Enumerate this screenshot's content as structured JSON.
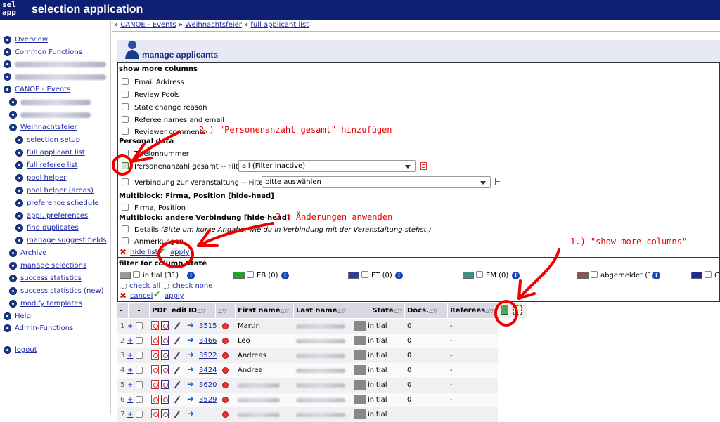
{
  "header": {
    "logo_line1": "sel",
    "logo_line2": "app",
    "title": "selection application"
  },
  "sidebar": {
    "overview": "Overview",
    "common_functions": "Common Functions",
    "canoe_events": "CANOE - Events",
    "weihnachtsfeier": "Weihnachtsfeier",
    "selection_setup": "selection setup",
    "full_applicant_list": "full applicant list",
    "full_referee_list": "full referee list",
    "pool_helper": "pool helper",
    "pool_helper_areas": "pool helper (areas)",
    "preference_schedule": "preference schedule",
    "appl_preferences": "appl. preferences",
    "find_duplicates": "find duplicates",
    "manage_suggest_fields": "manage suggest fields",
    "archive": "Archive",
    "manage_selections": "manage selections",
    "success_statistics": "success statistics",
    "success_statistics_new": "success statistics (new)",
    "modify_templates": "modify templates",
    "help": "Help",
    "admin_functions": "Admin-Functions",
    "logout": "logout"
  },
  "breadcrumb": {
    "prefix": "»",
    "c1": "CANOE - Events",
    "sep": "»",
    "c2": "Weihnachtsfeier",
    "c3": "full applicant list"
  },
  "page_title": "manage applicants",
  "columns_panel": {
    "heading": "show more columns",
    "email": "Email Address",
    "review_pools": "Review Pools",
    "state_change_reason": "State change reason",
    "referee_names": "Referee names and email",
    "reviewer_comments": "Reviewer comments",
    "personal_data_heading": "Personal data",
    "telefonnummer": "Telefonnummer",
    "personenanzahl": "Personenanzahl gesamt -- Filter:",
    "personenanzahl_select": "all (Filter inactive)",
    "verbindung": "Verbindung zur Veranstaltung -- Filter:",
    "verbindung_select": "bitte auswählen",
    "mb_firma_heading": "Multiblock: Firma, Position [hide-head]",
    "firma_position": "Firma, Position",
    "mb_verbindung_heading": "Multiblock: andere Verbindung [hide-head]",
    "details": "Details",
    "details_hint": "(Bitte um kurze Angabe, wie du in Verbindung mit der Veranstaltung stehst.)",
    "anmerkungen": "Anmerkungen",
    "hide_list": "hide list",
    "apply": "apply"
  },
  "state_filter": {
    "heading": "filter for column State",
    "states": [
      {
        "label": "initial (31)",
        "color": "#999999"
      },
      {
        "label": "EB (0)",
        "color": "#2ea02e"
      },
      {
        "label": "ET (0)",
        "color": "#2b3f99"
      },
      {
        "label": "EM (0)",
        "color": "#3f8f85"
      },
      {
        "label": "abgemeldet (1)",
        "color": "#8b5555"
      },
      {
        "label": "C",
        "color": "#1f2a8c"
      }
    ],
    "check_all": "check all",
    "check_none": "check none",
    "cancel": "cancel",
    "apply": "apply"
  },
  "table": {
    "headers": {
      "minus1": "-",
      "minus2": "-",
      "pdf": "PDF",
      "edit": "edit",
      "id": "ID",
      "first_name": "First name",
      "last_name": "Last name",
      "state": "State",
      "docs": "Docs.",
      "referees": "Referees"
    },
    "rows": [
      {
        "num": "1",
        "plus": "+",
        "id": "3515",
        "first": "Martin",
        "state": "initial",
        "docs": "0",
        "referees": "-"
      },
      {
        "num": "2",
        "plus": "+",
        "id": "3466",
        "first": "Leo",
        "state": "initial",
        "docs": "0",
        "referees": "-"
      },
      {
        "num": "3",
        "plus": "+",
        "id": "3522",
        "first": "Andreas",
        "state": "initial",
        "docs": "0",
        "referees": "-"
      },
      {
        "num": "4",
        "plus": "+",
        "id": "3424",
        "first": "Andrea",
        "state": "initial",
        "docs": "0",
        "referees": "-"
      },
      {
        "num": "5",
        "plus": "+",
        "id": "3620",
        "first": "",
        "state": "initial",
        "docs": "0",
        "referees": "-"
      },
      {
        "num": "6",
        "plus": "+",
        "id": "3529",
        "first": "",
        "state": "initial",
        "docs": "0",
        "referees": "-"
      },
      {
        "num": "7",
        "plus": "+",
        "id": "",
        "first": "",
        "state": "initial",
        "docs": "",
        "referees": ""
      }
    ]
  },
  "annotations": {
    "step1": "1.) \"show more columns\"",
    "step2": "2.) \"Personenanzahl gesamt\" hinzufügen",
    "step3": "3.) Änderungen anwenden"
  },
  "colors": {
    "header_bg": "#0f1f72",
    "link": "#1f2aa8",
    "annotation": "#e00000",
    "table_header": "#d8d9e3"
  }
}
